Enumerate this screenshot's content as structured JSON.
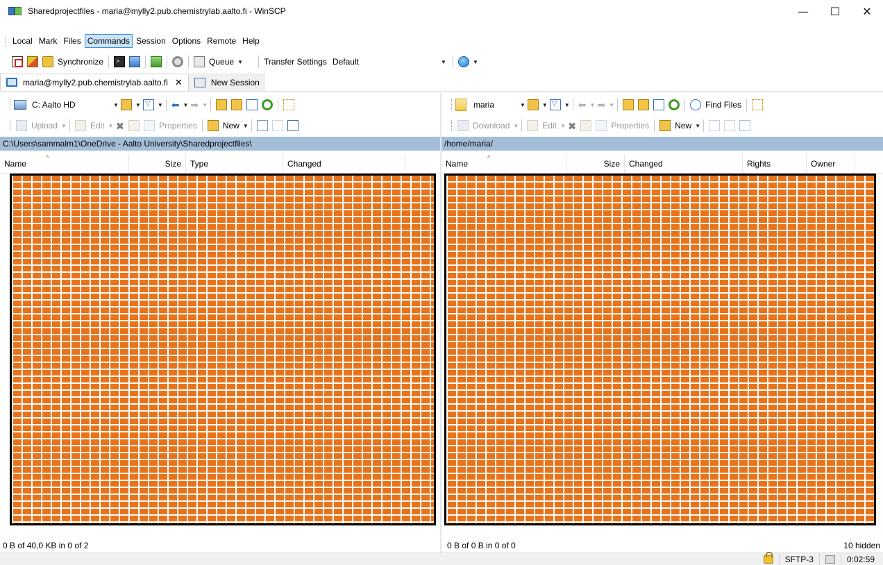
{
  "window": {
    "title": "Sharedprojectfiles - maria@mylly2.pub.chemistrylab.aalto.fi - WinSCP",
    "minimize": "—",
    "maximize": "☐",
    "close": "✕"
  },
  "menu": [
    "Local",
    "Mark",
    "Files",
    "Commands",
    "Session",
    "Options",
    "Remote",
    "Help"
  ],
  "menu_active": "Commands",
  "toolbar": {
    "synchronize": "Synchronize",
    "queue": "Queue",
    "transfer_settings_label": "Transfer Settings",
    "transfer_settings_value": "Default"
  },
  "tabs": {
    "session": "maria@mylly2.pub.chemistrylab.aalto.fi",
    "close": "✕",
    "new_session": "New Session"
  },
  "left": {
    "drive": "C: Aalto HD",
    "upload": "Upload",
    "edit": "Edit",
    "properties": "Properties",
    "new": "New",
    "path": "C:\\Users\\sammalm1\\OneDrive - Aalto University\\Sharedprojectfiles\\",
    "columns": [
      "Name",
      "Size",
      "Type",
      "Changed"
    ],
    "status": "0 B of 40,0 KB in 0 of 2"
  },
  "right": {
    "folder": "maria",
    "find_files": "Find Files",
    "download": "Download",
    "edit": "Edit",
    "properties": "Properties",
    "new": "New",
    "path": "/home/maria/",
    "columns": [
      "Name",
      "Size",
      "Changed",
      "Rights",
      "Owner"
    ],
    "status": "0 B of 0 B in 0 of 0",
    "hidden": "10 hidden"
  },
  "statusbar": {
    "protocol": "SFTP-3",
    "elapsed": "0:02:59"
  }
}
